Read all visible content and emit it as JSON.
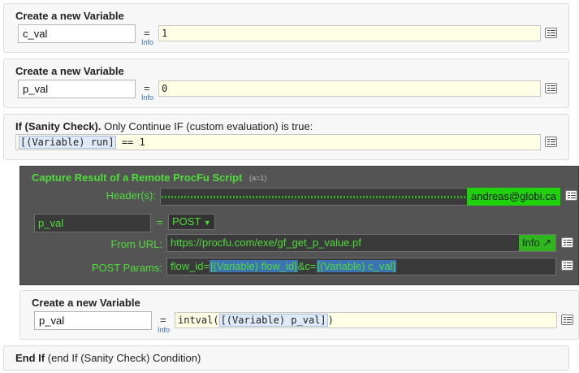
{
  "blocks": {
    "var1": {
      "title": "Create a new Variable",
      "name": "c_val",
      "eq": "=",
      "info": "Info",
      "value": "1"
    },
    "var2": {
      "title": "Create a new Variable",
      "name": "p_val",
      "eq": "=",
      "info": "Info",
      "value": "0"
    },
    "ifblock": {
      "title_bold": "If (Sanity Check).",
      "title_rest": "Only Continue IF (custom evaluation) is true:",
      "expr_var": "[(Variable) run]",
      "expr_rest": " == 1"
    },
    "capture": {
      "title": "Capture Result of a Remote ProcFu Script",
      "subtitle": "(a=1)",
      "headers_label": "Header(s):",
      "headers_email": "andreas@globi.ca",
      "result_var": "p_val",
      "eq": "=",
      "method": "POST",
      "method_arrow": "▼",
      "url_label": "From URL:",
      "url": "https://procfu.com/exe/gf_get_p_value.pf",
      "info_button": "Info ↗",
      "params_label": "POST Params:",
      "params_prefix": "flow_id=",
      "params_var1": "[(Variable) flow_id]",
      "params_mid": "&c=",
      "params_var2": "[(Variable) c_val]"
    },
    "var3": {
      "title": "Create a new Variable",
      "name": "p_val",
      "eq": "=",
      "info": "Info",
      "expr_prefix": "intval(",
      "expr_var": "[(Variable) p_val]",
      "expr_suffix": ")"
    },
    "endif": {
      "title_bold": "End If",
      "title_rest": "(end If (Sanity Check) Condition)"
    }
  },
  "colors": {
    "green_text": "#4fdc3c",
    "dark_panel": "#545454",
    "expr_bg": "#ffffe6",
    "info_link": "#3a73b8"
  }
}
